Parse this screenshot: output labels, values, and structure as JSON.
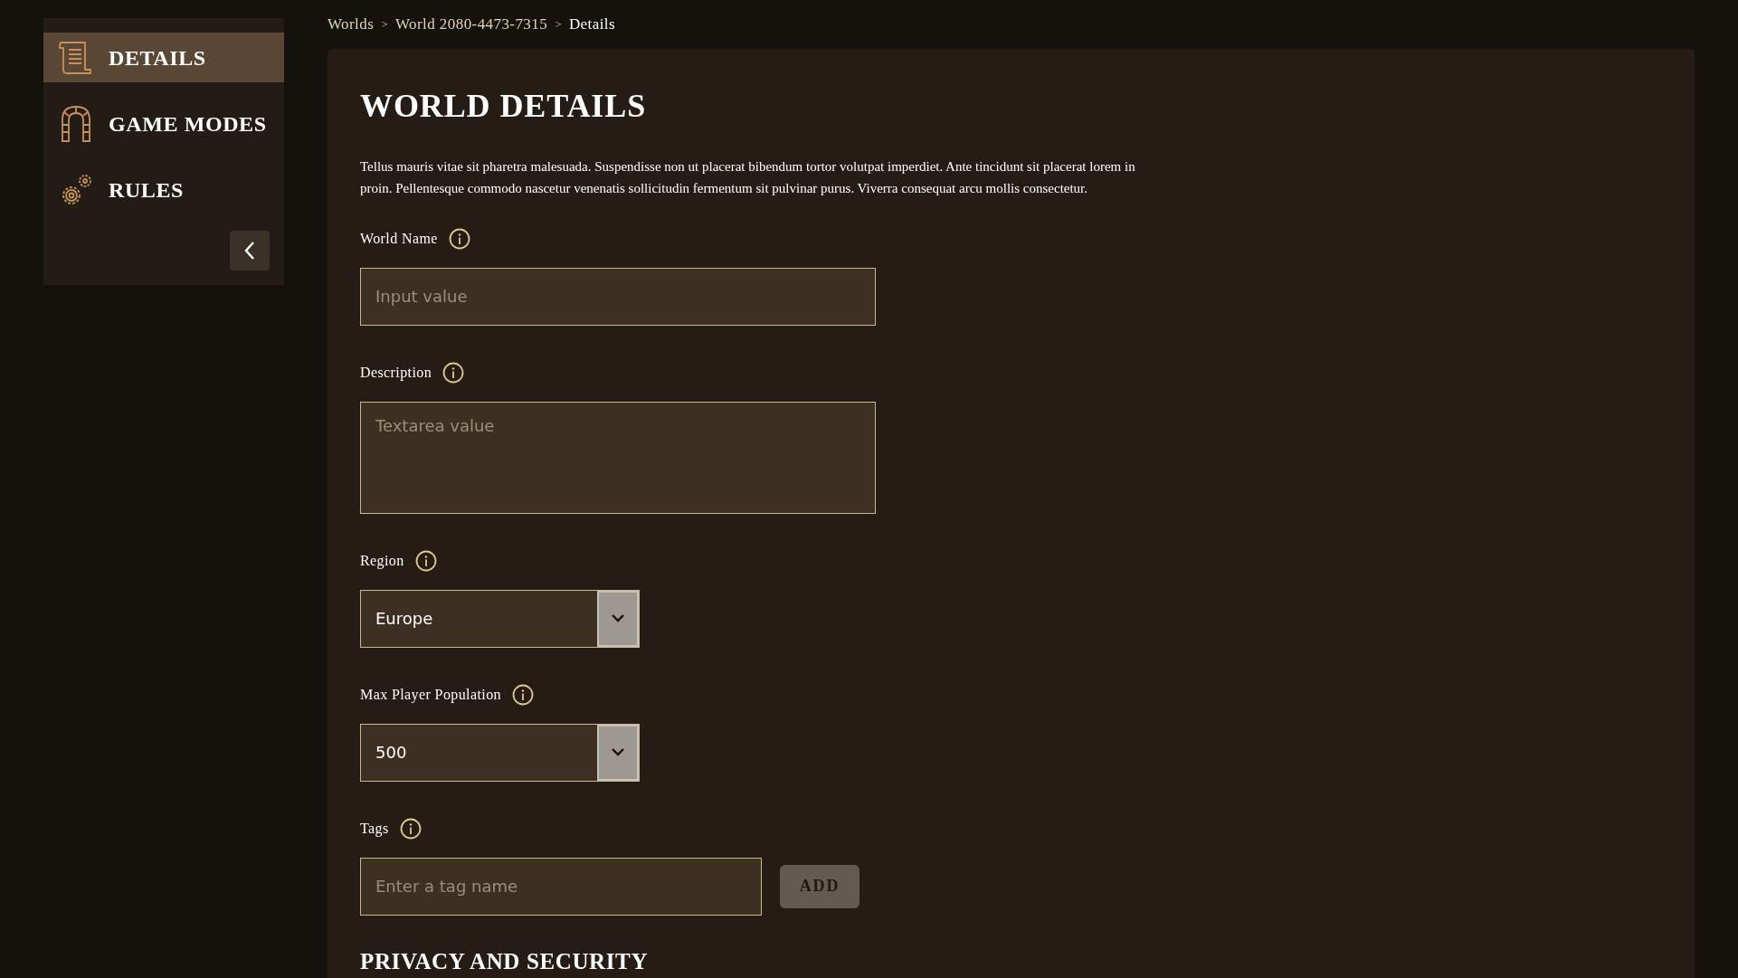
{
  "sidebar": {
    "items": [
      {
        "label": "DETAILS",
        "selected": true
      },
      {
        "label": "GAME MODES",
        "selected": false
      },
      {
        "label": "RULES",
        "selected": false
      }
    ]
  },
  "breadcrumb": [
    {
      "label": "Worlds",
      "current": false
    },
    {
      "label": "World 2080-4473-7315",
      "current": false
    },
    {
      "label": "Details",
      "current": true
    }
  ],
  "breadcrumb_separator": ">",
  "title": "WORLD DETAILS",
  "intro": "Tellus mauris vitae sit pharetra malesuada. Suspendisse non ut placerat bibendum tortor volutpat imperdiet. Ante tincidunt sit placerat lorem in proin. Pellentesque commodo nascetur venenatis sollicitudin fermentum sit pulvinar purus. Viverra consequat arcu mollis consectetur.",
  "fields": [
    {
      "kind": "text",
      "label": "World Name",
      "placeholder": "Input value"
    },
    {
      "kind": "textarea",
      "label": "Description",
      "placeholder": "Textarea value"
    },
    {
      "kind": "select",
      "label": "Region",
      "value": "Europe"
    },
    {
      "kind": "select",
      "label": "Max Player Population",
      "value": "500"
    },
    {
      "kind": "tags",
      "label": "Tags",
      "placeholder": "Enter a tag name",
      "button": "ADD"
    }
  ],
  "section_title": "PRIVACY AND SECURITY"
}
